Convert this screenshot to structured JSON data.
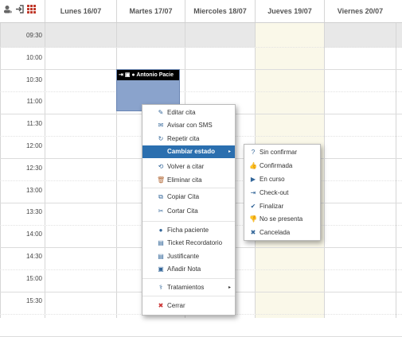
{
  "header": {
    "days": [
      "Lunes 16/07",
      "Martes 17/07",
      "Miercoles 18/07",
      "Jueves 19/07",
      "Viernes 20/07"
    ],
    "tools": [
      "user-settings-icon",
      "login-icon",
      "grid-view-icon"
    ]
  },
  "times": [
    "09:30",
    "10:00",
    "10:30",
    "11:00",
    "11:30",
    "12:00",
    "12:30",
    "13:00",
    "13:30",
    "14:00",
    "14:30",
    "15:00",
    "15:30"
  ],
  "event": {
    "patient": "Antonio Pacie"
  },
  "context_menu": {
    "items": [
      {
        "label": "Editar cita",
        "icon": "pencil-icon",
        "glyph": "✎",
        "color": "#336699"
      },
      {
        "label": "Avisar con SMS",
        "icon": "envelope-icon",
        "glyph": "✉",
        "color": "#336699"
      },
      {
        "label": "Repetir cita",
        "icon": "repeat-icon",
        "glyph": "↻",
        "color": "#336699"
      },
      {
        "label": "Cambiar estado",
        "icon": "",
        "glyph": "",
        "color": "#ffffff",
        "active": true,
        "submenu": true
      },
      {
        "label": "Volver a citar",
        "icon": "refresh-icon",
        "glyph": "⟲",
        "color": "#336699"
      },
      {
        "label": "Eliminar cita",
        "icon": "trash-icon",
        "glyph": "🗑",
        "color": "#b36b3a"
      },
      {
        "label": "Copiar Cita",
        "icon": "copy-icon",
        "glyph": "⧉",
        "color": "#336699"
      },
      {
        "label": "Cortar Cita",
        "icon": "scissors-icon",
        "glyph": "✂",
        "color": "#336699"
      },
      {
        "label": "Ficha paciente",
        "icon": "user-icon",
        "glyph": "●",
        "color": "#336699"
      },
      {
        "label": "Ticket Recordatorio",
        "icon": "printer-icon",
        "glyph": "▤",
        "color": "#336699"
      },
      {
        "label": "Justificante",
        "icon": "printer-icon",
        "glyph": "▤",
        "color": "#336699"
      },
      {
        "label": "Añadir Nota",
        "icon": "note-icon",
        "glyph": "▣",
        "color": "#336699"
      },
      {
        "label": "Tratamientos",
        "icon": "stethoscope-icon",
        "glyph": "⚕",
        "color": "#336699",
        "submenu": true
      },
      {
        "label": "Cerrar",
        "icon": "close-icon",
        "glyph": "✖",
        "color": "#cc3333"
      }
    ]
  },
  "status_menu": {
    "items": [
      {
        "label": "Sin confirmar",
        "icon": "question-icon",
        "glyph": "?",
        "color": "#336699"
      },
      {
        "label": "Confirmada",
        "icon": "thumbs-up-icon",
        "glyph": "👍",
        "color": "#336699"
      },
      {
        "label": "En curso",
        "icon": "in-progress-icon",
        "glyph": "▶",
        "color": "#336699"
      },
      {
        "label": "Check-out",
        "icon": "checkout-icon",
        "glyph": "⇥",
        "color": "#336699"
      },
      {
        "label": "Finalizar",
        "icon": "check-icon",
        "glyph": "✔",
        "color": "#336699"
      },
      {
        "label": "No se presenta",
        "icon": "thumbs-down-icon",
        "glyph": "👎",
        "color": "#336699"
      },
      {
        "label": "Cancelada",
        "icon": "cancel-icon",
        "glyph": "✖",
        "color": "#336699"
      }
    ]
  }
}
